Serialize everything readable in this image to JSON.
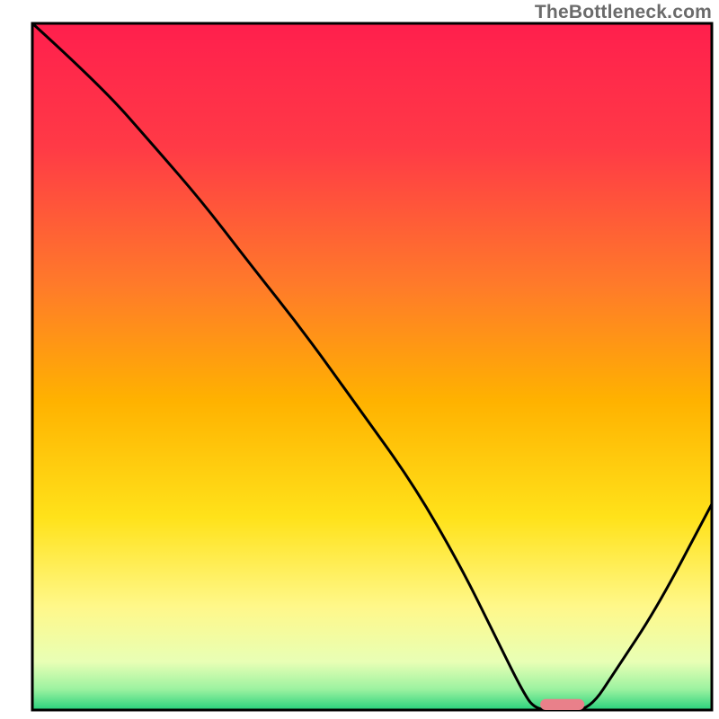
{
  "watermark": "TheBottleneck.com",
  "chart_data": {
    "type": "line",
    "title": "",
    "xlabel": "",
    "ylabel": "",
    "xlim": [
      0,
      100
    ],
    "ylim": [
      0,
      100
    ],
    "grid": false,
    "legend": false,
    "background_gradient_stops": [
      {
        "offset": 0.0,
        "color": "#ff1f4d"
      },
      {
        "offset": 0.18,
        "color": "#ff3a46"
      },
      {
        "offset": 0.38,
        "color": "#ff7a2a"
      },
      {
        "offset": 0.55,
        "color": "#ffb200"
      },
      {
        "offset": 0.72,
        "color": "#ffe21a"
      },
      {
        "offset": 0.85,
        "color": "#fff88a"
      },
      {
        "offset": 0.93,
        "color": "#e8ffb5"
      },
      {
        "offset": 0.97,
        "color": "#9bf2a0"
      },
      {
        "offset": 1.0,
        "color": "#28d17c"
      }
    ],
    "series": [
      {
        "name": "bottleneck-curve",
        "color": "#000000",
        "x": [
          0,
          10,
          18,
          25,
          32,
          40,
          48,
          56,
          63,
          68,
          72,
          74,
          78,
          82,
          86,
          92,
          100
        ],
        "y": [
          100,
          91,
          82,
          74,
          65,
          55,
          44,
          33,
          21,
          11,
          3,
          0,
          0,
          0,
          6,
          15,
          30
        ]
      }
    ],
    "marker": {
      "name": "optimal-point",
      "x_center": 78,
      "y": 0.8,
      "width": 6.5,
      "height": 1.6,
      "color": "#e9808a"
    }
  }
}
